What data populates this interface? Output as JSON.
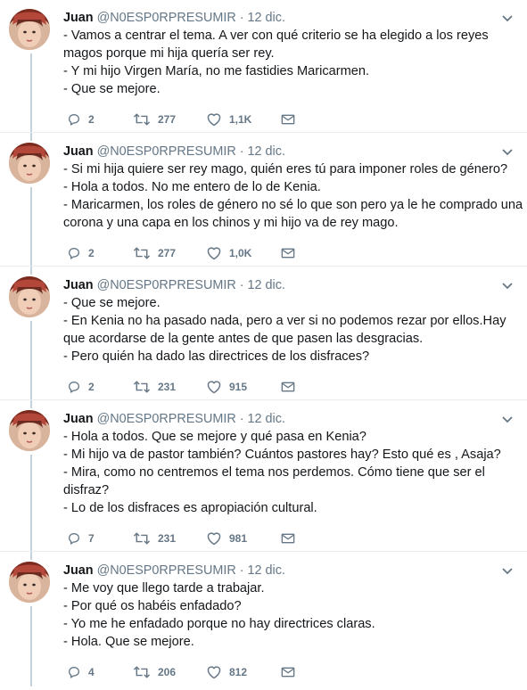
{
  "author": {
    "name": "Juan",
    "handle": "@N0ESP0RPRESUMIR",
    "dot": "·"
  },
  "tweets": [
    {
      "date": "12 dic.",
      "lines": [
        "- Vamos a centrar el tema. A ver con qué criterio se ha elegido a los reyes",
        "magos porque mi hija quería ser rey.",
        "- Y mi hijo Virgen María, no me fastidies Maricarmen.",
        "- Que se mejore."
      ],
      "replies": "2",
      "retweets": "277",
      "likes": "1,1K"
    },
    {
      "date": "12 dic.",
      "lines": [
        "- Si mi hija quiere ser rey mago, quién eres tú para imponer roles de género?",
        "- Hola a todos. No me entero de lo de Kenia.",
        "- Maricarmen, los roles de género no sé lo que son pero ya le he comprado una",
        "corona y una capa en los chinos y mi hijo va de rey mago."
      ],
      "replies": "2",
      "retweets": "277",
      "likes": "1,0K"
    },
    {
      "date": "12 dic.",
      "lines": [
        "- Que se mejore.",
        "- En Kenia no ha pasado nada, pero a ver si no podemos rezar por ellos.Hay",
        "que acordarse de la gente antes de que pasen las desgracias.",
        "- Pero quién ha dado las directrices de los disfraces?"
      ],
      "replies": "2",
      "retweets": "231",
      "likes": "915"
    },
    {
      "date": "12 dic.",
      "lines": [
        "- Hola a todos. Que se mejore y qué pasa en Kenia?",
        "- Mi hijo va de pastor también? Cuántos pastores hay? Esto qué es , Asaja?",
        "- Mira, como no centremos el tema nos perdemos. Cómo tiene que ser el",
        "disfraz?",
        "- Lo de los disfraces es apropiación cultural."
      ],
      "replies": "7",
      "retweets": "231",
      "likes": "981"
    },
    {
      "date": "12 dic.",
      "lines": [
        "- Me voy que llego tarde a trabajar.",
        "- Por qué os habéis enfadado?",
        "- Yo me he enfadado porque no hay directrices claras.",
        "- Hola. Que se mejore."
      ],
      "replies": "4",
      "retweets": "206",
      "likes": "812"
    }
  ],
  "icons": {
    "reply": "reply-icon",
    "retweet": "retweet-icon",
    "like": "heart-icon",
    "dm": "envelope-icon",
    "caret": "chevron-down-icon"
  },
  "colors": {
    "text": "#14171a",
    "muted": "#657786",
    "thread": "#c4d0da",
    "divider": "#e6ecf0"
  }
}
